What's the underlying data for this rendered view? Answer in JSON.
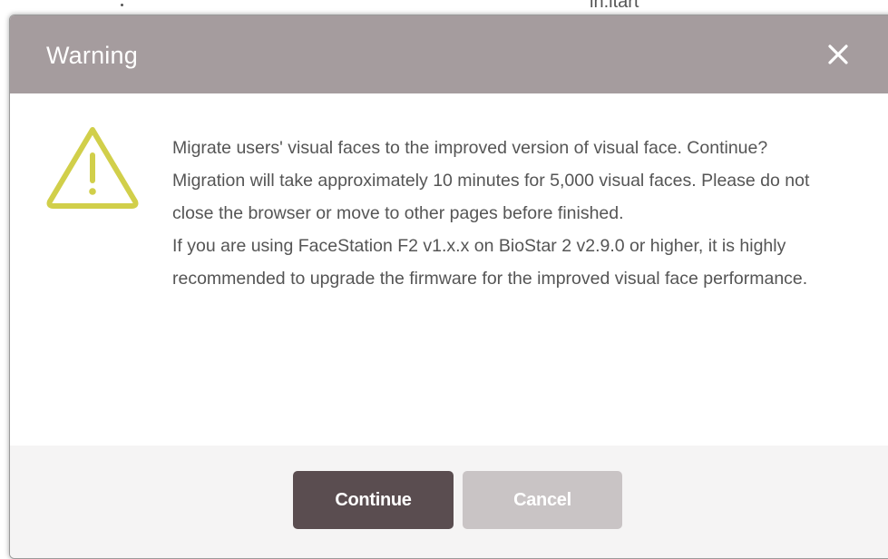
{
  "background": {
    "partial_text": "in.itart"
  },
  "dialog": {
    "title": "Warning",
    "close_icon": "close-icon",
    "warning_icon": "warning-triangle-icon",
    "warning_color": "#d1cf4a",
    "header_color": "#a59c9e",
    "message": {
      "paragraph_1": "Migrate users' visual faces to the improved version of visual face. Continue?",
      "paragraph_2": "Migration will take approximately 10 minutes for 5,000 visual faces. Please do not close the browser or move to other pages before finished.",
      "paragraph_3": "If you are using FaceStation F2 v1.x.x on BioStar 2 v2.9.0 or higher, it is highly recommended to upgrade the firmware for the improved visual face performance."
    },
    "buttons": {
      "continue_label": "Continue",
      "cancel_label": "Cancel",
      "continue_color": "#5a4d50",
      "cancel_color": "#c9c4c5"
    }
  }
}
